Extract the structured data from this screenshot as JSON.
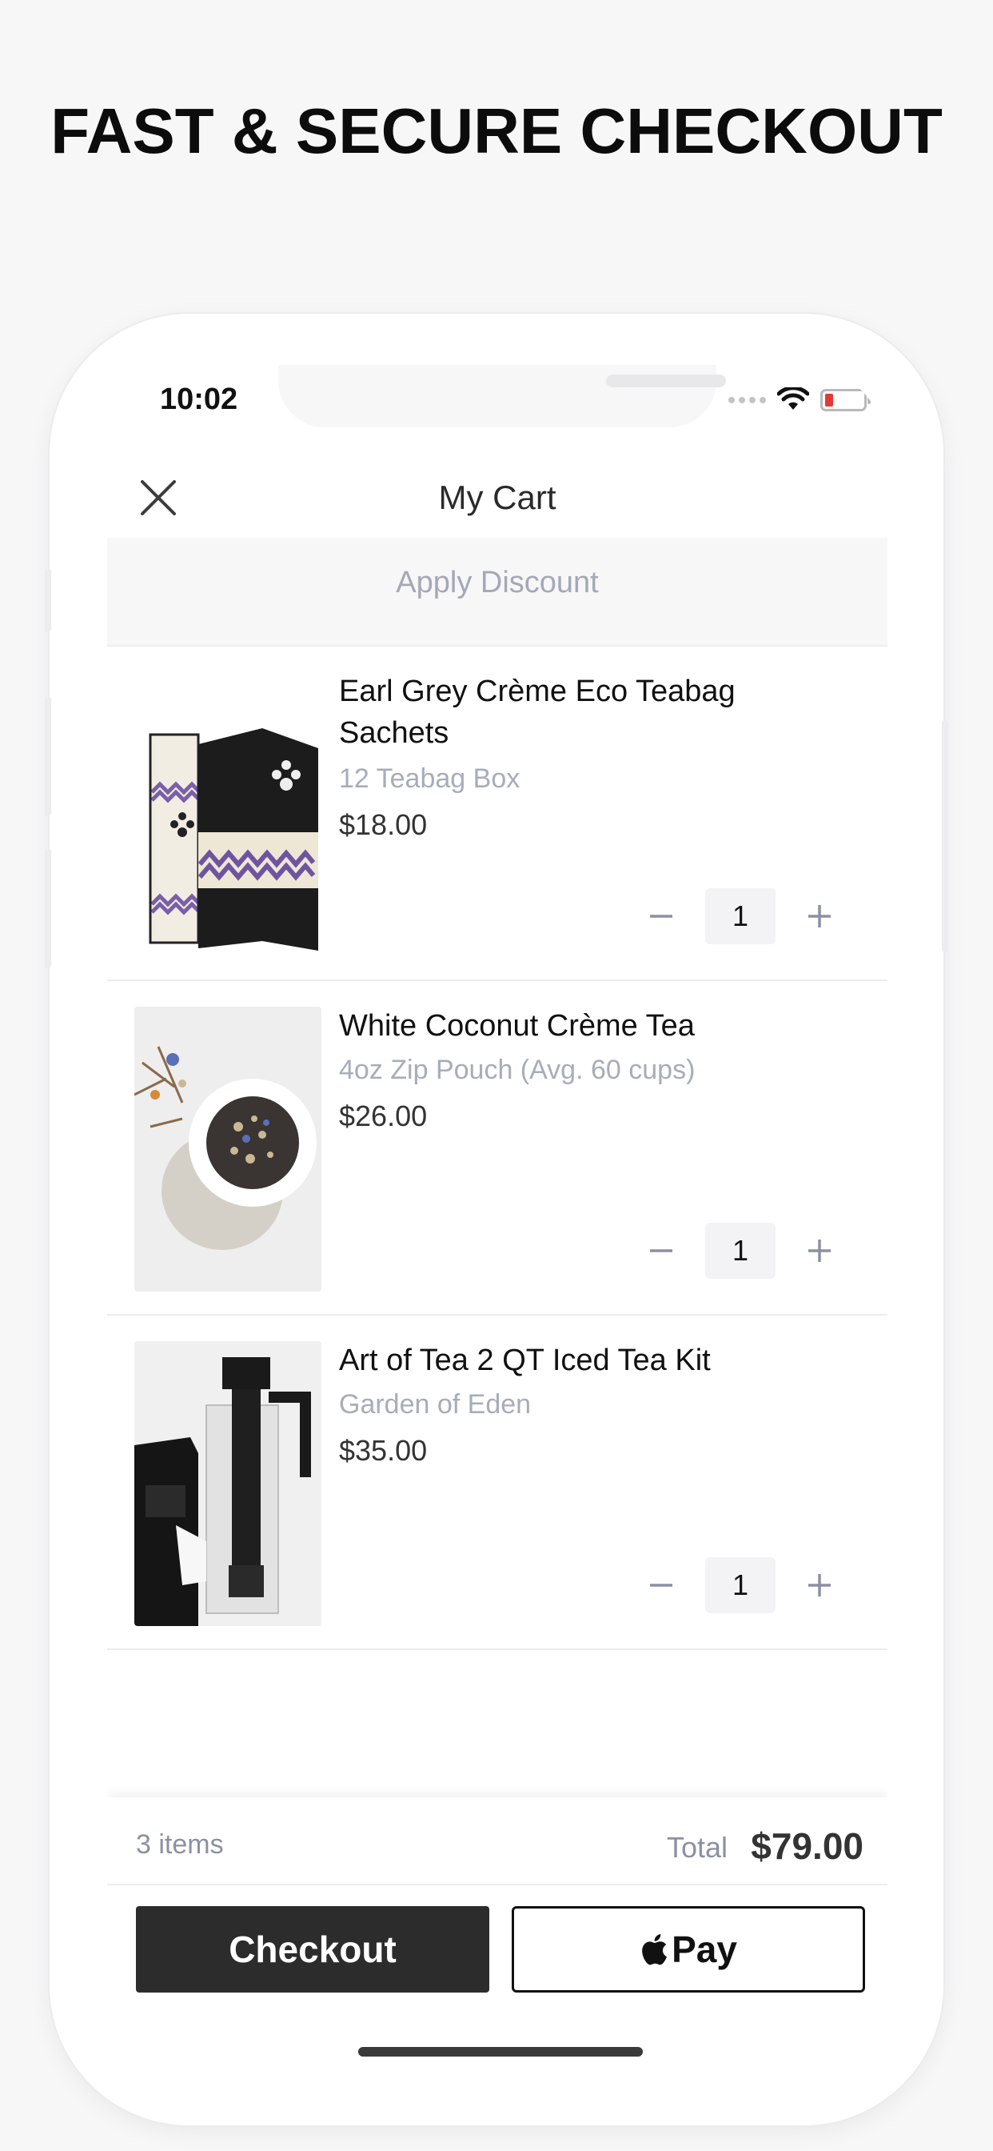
{
  "headline": "FAST & SECURE CHECKOUT",
  "status_bar": {
    "time": "10:02"
  },
  "nav": {
    "title": "My Cart"
  },
  "discount": {
    "label": "Apply Discount"
  },
  "items": [
    {
      "name": "Earl Grey Crème Eco Teabag Sachets",
      "variant": "12 Teabag Box",
      "price": "$18.00",
      "qty": "1"
    },
    {
      "name": "White Coconut Crème Tea",
      "variant": "4oz Zip Pouch (Avg. 60 cups)",
      "price": "$26.00",
      "qty": "1"
    },
    {
      "name": "Art of Tea 2 QT Iced Tea Kit",
      "variant": "Garden of Eden",
      "price": "$35.00",
      "qty": "1"
    }
  ],
  "summary": {
    "count": "3 items",
    "total_label": "Total",
    "total": "$79.00"
  },
  "buttons": {
    "checkout": "Checkout",
    "apple_pay": "Pay"
  },
  "icons": {
    "close": "close-icon",
    "minus": "minus-icon",
    "plus": "plus-icon",
    "apple": "apple-logo-icon"
  },
  "colors": {
    "accent_dark": "#2c2c2c",
    "muted": "#a5a8b6",
    "battery_low": "#e53935"
  }
}
